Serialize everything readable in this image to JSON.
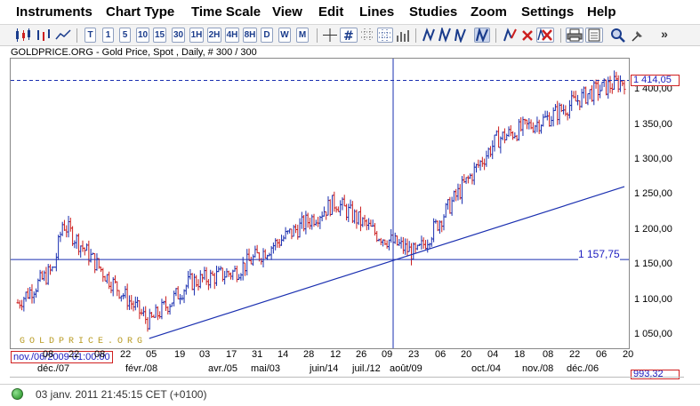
{
  "menu": [
    "Instruments",
    "Chart Type",
    "Time Scale",
    "View",
    "Edit",
    "Lines",
    "Studies",
    "Zoom",
    "Settings",
    "Help"
  ],
  "toolbar": {
    "period_buttons": [
      "T",
      "1",
      "5",
      "10",
      "15",
      "30",
      "1H",
      "2H",
      "4H",
      "8H",
      "D",
      "W",
      "M"
    ]
  },
  "chart": {
    "title": "GOLDPRICE.ORG - Gold Price, Spot , Daily, # 300 / 300",
    "price_labels": [
      "1 400,00",
      "1 350,00",
      "1 300,00",
      "1 250,00",
      "1 200,00",
      "1 150,00",
      "1 100,00",
      "1 050,00"
    ],
    "current_price": "1 414,05",
    "crosshair_price": "1 157,75",
    "crosshair_date": "nov./06/2009 01:00:00",
    "low_price": "993,32",
    "watermark": "GOLDPRICE.ORG",
    "x_ticks_top": [
      "08",
      "22",
      "08",
      "22",
      "05",
      "19",
      "03",
      "17",
      "31",
      "14",
      "28",
      "12",
      "26",
      "09",
      "23",
      "06",
      "20",
      "04",
      "18",
      "08",
      "22",
      "06",
      "20"
    ],
    "x_ticks_bottom": [
      "déc./07",
      "févr./08",
      "avr./05",
      "mai/03",
      "juin/14",
      "juil./12",
      "août/09",
      "oct./04",
      "nov./08",
      "déc./06"
    ],
    "colors": {
      "up": "#1a2fb0",
      "down": "#cc1f1f",
      "line": "#1a2fb0",
      "frame": "#888888"
    }
  },
  "chart_data": {
    "type": "ohlc",
    "title": "GOLDPRICE.ORG - Gold Price, Spot , Daily, # 300 / 300",
    "ylim": [
      1025,
      1435
    ],
    "y_ticks": [
      1050,
      1100,
      1150,
      1200,
      1250,
      1300,
      1350,
      1400
    ],
    "x": [
      "2009-11-06",
      "2009-12-01",
      "2009-12-07",
      "2010-01-08",
      "2010-02-05",
      "2010-03-05",
      "2010-04-05",
      "2010-05-03",
      "2010-06-14",
      "2010-07-12",
      "2010-08-09",
      "2010-09-06",
      "2010-10-04",
      "2010-11-08",
      "2010-12-06",
      "2010-12-31"
    ],
    "close": [
      1096,
      1145,
      1210,
      1130,
      1068,
      1125,
      1140,
      1180,
      1240,
      1195,
      1165,
      1250,
      1330,
      1360,
      1395,
      1414
    ],
    "current_price": 1414.05,
    "horizontal_line": 1157.75,
    "trendline": {
      "from": [
        "2010-02-05",
        1045
      ],
      "to": [
        "2010-12-31",
        1262
      ]
    }
  },
  "status": {
    "datetime": "03 janv. 2011 21:45:15  CET (+0100)"
  }
}
